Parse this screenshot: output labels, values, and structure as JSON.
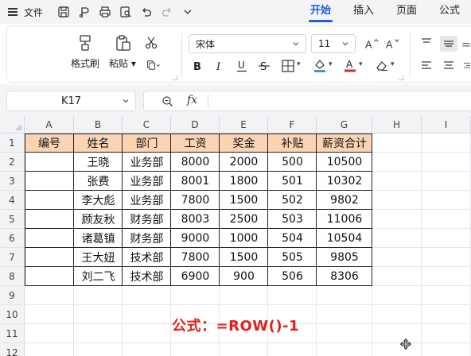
{
  "menu": {
    "file_label": "文件",
    "tabs": [
      {
        "label": "开始",
        "active": true
      },
      {
        "label": "插入",
        "active": false
      },
      {
        "label": "页面",
        "active": false
      },
      {
        "label": "公式",
        "active": false
      }
    ]
  },
  "ribbon": {
    "format_painter_label": "格式刷",
    "paste_label": "粘贴",
    "font_name": "宋体",
    "font_size": "11"
  },
  "formula_bar": {
    "name_box": "K17",
    "fx_label": "fx",
    "formula": ""
  },
  "grid": {
    "columns": [
      "A",
      "B",
      "C",
      "D",
      "E",
      "F",
      "G",
      "H",
      "I"
    ],
    "rows": [
      "1",
      "2",
      "3",
      "4",
      "5",
      "6",
      "7",
      "8",
      "9",
      "10",
      "11",
      "12"
    ],
    "table": {
      "headers": [
        "编号",
        "姓名",
        "部门",
        "工资",
        "奖金",
        "补贴",
        "薪资合计"
      ],
      "rows": [
        [
          "",
          "王晓",
          "业务部",
          "8000",
          "2000",
          "500",
          "10500"
        ],
        [
          "",
          "张费",
          "业务部",
          "8001",
          "1800",
          "501",
          "10302"
        ],
        [
          "",
          "李大彪",
          "业务部",
          "7800",
          "1500",
          "502",
          "9802"
        ],
        [
          "",
          "顾友秋",
          "财务部",
          "8003",
          "2500",
          "503",
          "11006"
        ],
        [
          "",
          "诸葛镇",
          "财务部",
          "9000",
          "1000",
          "504",
          "10504"
        ],
        [
          "",
          "王大妞",
          "技术部",
          "7800",
          "1500",
          "505",
          "9805"
        ],
        [
          "",
          "刘二飞",
          "技术部",
          "6900",
          "900",
          "506",
          "8306"
        ]
      ]
    },
    "annotation": "公式：=ROW()-1"
  },
  "colors": {
    "accent": "#1f5fd8",
    "header_fill": "#fbd4b4",
    "annotation": "#e0201b",
    "font_color_bar": "#d9272e",
    "fill_color_bar": "#4a90d9"
  }
}
